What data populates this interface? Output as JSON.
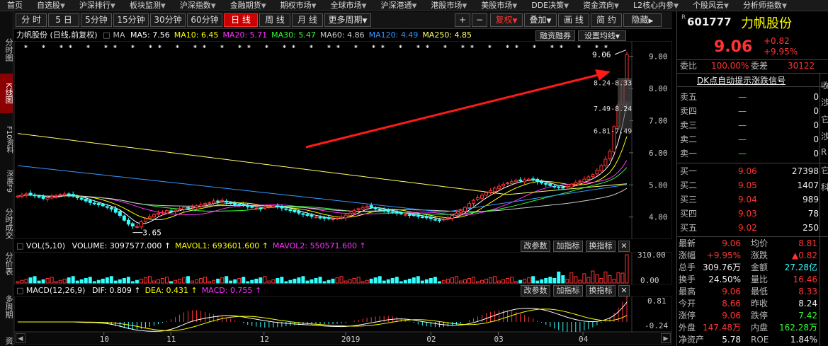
{
  "topnav": [
    {
      "label": "首页"
    },
    {
      "label": "自选股",
      "arrow": true
    },
    {
      "label": "沪深排行",
      "arrow": true
    },
    {
      "label": "板块监测",
      "arrow": true
    },
    {
      "label": "沪深指数",
      "arrow": true
    },
    {
      "label": "金融期货",
      "arrow": true
    },
    {
      "label": "期权市场",
      "arrow": true
    },
    {
      "label": "全球市场",
      "arrow": true
    },
    {
      "label": "沪深港通",
      "arrow": true
    },
    {
      "label": "港股市场",
      "arrow": true
    },
    {
      "label": "美股市场",
      "arrow": true
    },
    {
      "label": "DDE决策",
      "arrow": true
    },
    {
      "label": "资金流向",
      "arrow": true
    },
    {
      "label": "L2核心内参",
      "arrow": true
    },
    {
      "label": "个股风云",
      "arrow": true
    },
    {
      "label": "分析师指数",
      "arrow": true
    }
  ],
  "leftbar": [
    "分时图",
    "K线图",
    "F10资料",
    "深度F9",
    "分时成交",
    "分价表",
    "多周期",
    "资"
  ],
  "toolbar": {
    "periods": [
      "分 时",
      "5 日",
      "5分钟",
      "15分钟",
      "30分钟",
      "60分钟",
      "日 线",
      "周 线",
      "月 线",
      "更多周期"
    ],
    "more_arrow": "▼",
    "plus": "+",
    "minus": "−",
    "fuquan": "复权",
    "fuquan_arrow": "▼",
    "diejia": "叠加",
    "diejia_arrow": "▼",
    "huaxian": "画 线",
    "jianyue": "简 约",
    "yincang": "隐藏",
    "yincang_arrow": "▶"
  },
  "chart_header": {
    "title": "力帆股份 (日线,前复权)",
    "ma_label": "MA",
    "ma": [
      {
        "name": "MA5:",
        "value": "7.56",
        "color": "#ffffff"
      },
      {
        "name": "MA10:",
        "value": "6.45",
        "color": "#ffff00"
      },
      {
        "name": "MA20:",
        "value": "5.71",
        "color": "#ff33ff"
      },
      {
        "name": "MA30:",
        "value": "5.47",
        "color": "#33ff33"
      },
      {
        "name": "MA60:",
        "value": "4.86",
        "color": "#cccccc"
      },
      {
        "name": "MA120:",
        "value": "4.49",
        "color": "#3399ff"
      },
      {
        "name": "MA250:",
        "value": "4.85",
        "color": "#ffff66"
      }
    ],
    "btn_rongzi": "融资融券",
    "btn_setma": "设置均线",
    "btn_setma_arrow": "▼"
  },
  "colors": {
    "up": "#ff3333",
    "down": "#33ffff",
    "ma5": "#ffffff",
    "ma10": "#ffff00",
    "ma20": "#ff33ff",
    "ma30": "#33ff33",
    "ma60": "#cccccc",
    "ma120": "#3399ff",
    "ma250": "#ffff66",
    "vol": "#ff3333",
    "macd": "#ff3333"
  },
  "chart_data": [
    {
      "type": "candlestick",
      "y_ticks": [
        "9.00",
        "8.00",
        "7.00",
        "6.00",
        "5.00",
        "4.00"
      ],
      "ylim": [
        3.4,
        9.3
      ],
      "x_ticks": [
        "10",
        "11",
        "12",
        "2019",
        "02",
        "03",
        "04"
      ],
      "annotations": {
        "high_label": "9.06",
        "low_label": "3.65",
        "low_marker": "S",
        "bands": [
          "8.24-8.33",
          "7.49-8.24",
          "6.81-7.49"
        ]
      },
      "note": "Daily candles; approximate close values read from the chart",
      "closes": [
        4.65,
        4.68,
        4.72,
        4.7,
        4.66,
        4.62,
        4.58,
        4.6,
        4.64,
        4.66,
        4.7,
        4.72,
        4.69,
        4.65,
        4.6,
        4.55,
        4.5,
        4.45,
        4.42,
        4.38,
        4.35,
        4.3,
        4.25,
        4.15,
        4.05,
        3.9,
        3.78,
        3.72,
        3.7,
        3.85,
        3.95,
        4.02,
        4.08,
        4.12,
        4.15,
        4.2,
        4.18,
        4.22,
        4.26,
        4.3,
        4.28,
        4.32,
        4.35,
        4.38,
        4.42,
        4.45,
        4.5,
        4.48,
        4.52,
        4.46,
        4.42,
        4.38,
        4.4,
        4.36,
        4.32,
        4.3,
        4.28,
        4.26,
        4.3,
        4.33,
        4.35,
        4.32,
        4.28,
        4.24,
        4.2,
        4.16,
        4.12,
        4.08,
        4.05,
        4.02,
        4.0,
        3.98,
        3.96,
        3.95,
        3.94,
        3.96,
        4.0,
        4.06,
        4.12,
        4.2,
        4.26,
        4.3,
        4.34,
        4.3,
        4.26,
        4.22,
        4.2,
        4.18,
        4.15,
        4.12,
        4.1,
        4.08,
        4.06,
        4.05,
        4.02,
        4.0,
        3.98,
        3.95,
        3.92,
        3.9,
        3.93,
        3.98,
        4.05,
        4.12,
        4.2,
        4.3,
        4.42,
        4.52,
        4.6,
        4.68,
        4.76,
        4.82,
        4.9,
        4.96,
        5.02,
        5.06,
        5.1,
        5.14,
        5.12,
        5.16,
        5.18,
        5.15,
        5.1,
        5.06,
        5.02,
        4.98,
        4.95,
        4.92,
        4.9,
        4.95,
        5.02,
        5.08,
        5.12,
        5.18,
        5.25,
        5.32,
        5.45,
        5.6,
        5.8,
        6.05,
        6.81,
        7.49,
        8.24,
        9.06
      ]
    },
    {
      "type": "volume",
      "title": "VOL(5,10)",
      "legend": [
        {
          "name": "VOLUME:",
          "value": "3097577.000",
          "color": "#ffffff"
        },
        {
          "name": "MAVOL1:",
          "value": "693601.600",
          "color": "#ffff00"
        },
        {
          "name": "MAVOL2:",
          "value": "550571.600",
          "color": "#ff33ff"
        }
      ],
      "y_ticks": [
        "310.00",
        "0.00"
      ]
    },
    {
      "type": "macd",
      "title": "MACD(12,26,9)",
      "legend": [
        {
          "name": "DIF:",
          "value": "0.809",
          "color": "#ffffff"
        },
        {
          "name": "DEA:",
          "value": "0.431",
          "color": "#ffff00"
        },
        {
          "name": "MACD:",
          "value": "0.755",
          "color": "#ff33ff"
        }
      ],
      "y_ticks": [
        "0.81",
        "-0.24"
      ]
    }
  ],
  "panel_buttons": {
    "params": "改参数",
    "add": "加指标",
    "switch": "换指标",
    "close": "✕"
  },
  "bottom_scroll": {
    "left": "◀",
    "right": "▶"
  },
  "quote": {
    "r_badge": "R",
    "code": "601777",
    "name": "力帆股份",
    "price": "9.06",
    "change": "+0.82",
    "change_pct": "+9.95%",
    "weibi_label": "委比",
    "weibi": "100.00%",
    "weicha_label": "委差",
    "weicha": "30122",
    "signal": "DK点自动提示涨跌信号",
    "asks": [
      {
        "label": "卖五",
        "price": "—",
        "vol": "0"
      },
      {
        "label": "卖四",
        "price": "—",
        "vol": "0"
      },
      {
        "label": "卖三",
        "price": "—",
        "vol": "0"
      },
      {
        "label": "卖二",
        "price": "—",
        "vol": "0"
      },
      {
        "label": "卖一",
        "price": "—",
        "vol": "0"
      }
    ],
    "bids": [
      {
        "label": "买一",
        "price": "9.06",
        "vol": "27398"
      },
      {
        "label": "买二",
        "price": "9.05",
        "vol": "1407"
      },
      {
        "label": "买三",
        "price": "9.04",
        "vol": "989"
      },
      {
        "label": "买四",
        "price": "9.03",
        "vol": "78"
      },
      {
        "label": "买五",
        "price": "9.02",
        "vol": "250"
      }
    ],
    "stats": [
      {
        "l1": "最新",
        "v1": "9.06",
        "c1": "red",
        "l2": "均价",
        "v2": "8.81",
        "c2": "red"
      },
      {
        "l1": "涨幅",
        "v1": "+9.95%",
        "c1": "red",
        "l2": "涨跌",
        "v2": "▲0.82",
        "c2": "red"
      },
      {
        "l1": "总手",
        "v1": "309.76万",
        "c1": "white",
        "l2": "金额",
        "v2": "27.28亿",
        "c2": "cyan"
      },
      {
        "l1": "换手",
        "v1": "24.50%",
        "c1": "white",
        "l2": "量比",
        "v2": "16.46",
        "c2": "red"
      },
      {
        "l1": "最高",
        "v1": "9.06",
        "c1": "red",
        "l2": "最低",
        "v2": "8.33",
        "c2": "red"
      },
      {
        "l1": "今开",
        "v1": "8.66",
        "c1": "red",
        "l2": "昨收",
        "v2": "8.24",
        "c2": "white"
      },
      {
        "l1": "涨停",
        "v1": "9.06",
        "c1": "red",
        "l2": "跌停",
        "v2": "7.42",
        "c2": "green"
      },
      {
        "l1": "外盘",
        "v1": "147.48万",
        "c1": "red",
        "l2": "内盘",
        "v2": "162.28万",
        "c2": "green"
      },
      {
        "l1": "净资产",
        "v1": "5.78",
        "c1": "white",
        "l2": "ROE",
        "v2": "1.84%",
        "c2": "white"
      }
    ],
    "side_chars": [
      "收",
      "涉",
      "它",
      "涉",
      "R",
      "它",
      "科"
    ]
  }
}
